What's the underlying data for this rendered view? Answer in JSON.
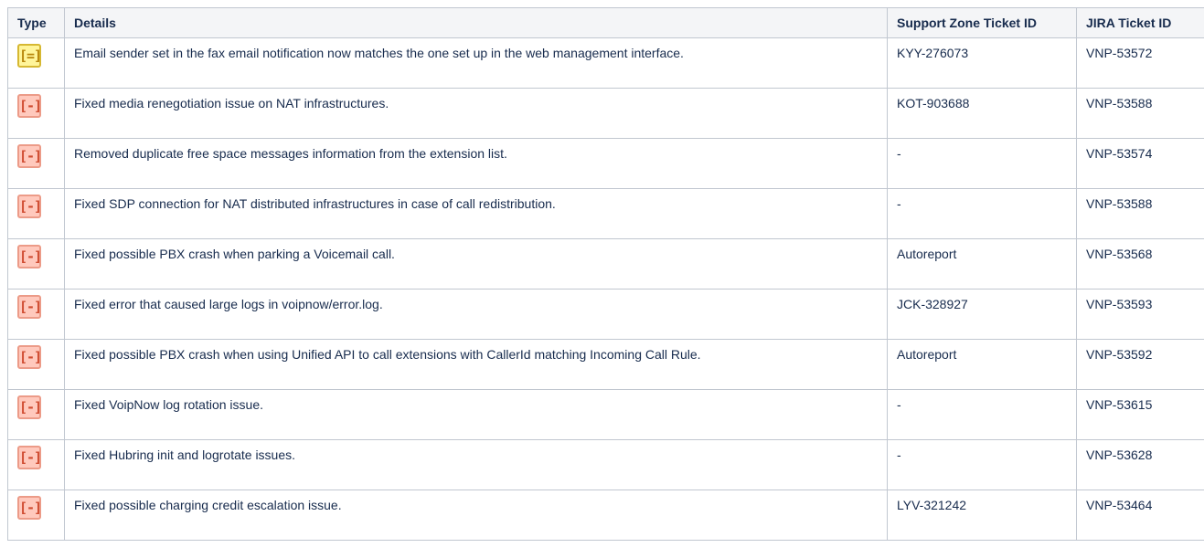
{
  "table": {
    "headers": {
      "type": "Type",
      "details": "Details",
      "support_zone": "Support Zone Ticket ID",
      "jira": "JIRA Ticket ID"
    },
    "rows": [
      {
        "icon": "changed-icon",
        "icon_glyph": "[=]",
        "details": "Email sender set in the fax email notification now matches the one set up in the web management interface.",
        "support_zone": "KYY-276073",
        "jira": "VNP-53572"
      },
      {
        "icon": "fixed-icon",
        "icon_glyph": "[-]",
        "details": "Fixed media renegotiation issue on NAT infrastructures.",
        "support_zone": "KOT-903688",
        "jira": "VNP-53588"
      },
      {
        "icon": "fixed-icon",
        "icon_glyph": "[-]",
        "details": "Removed duplicate free space messages information from the extension list.",
        "support_zone": "-",
        "jira": "VNP-53574"
      },
      {
        "icon": "fixed-icon",
        "icon_glyph": "[-]",
        "details": "Fixed SDP connection for NAT distributed infrastructures in case of call redistribution.",
        "support_zone": "-",
        "jira": "VNP-53588"
      },
      {
        "icon": "fixed-icon",
        "icon_glyph": "[-]",
        "details": "Fixed possible PBX crash when parking a Voicemail call.",
        "support_zone": "Autoreport",
        "jira": "VNP-53568"
      },
      {
        "icon": "fixed-icon",
        "icon_glyph": "[-]",
        "details": "Fixed error that caused large logs in voipnow/error.log.",
        "support_zone": "JCK-328927",
        "jira": "VNP-53593"
      },
      {
        "icon": "fixed-icon",
        "icon_glyph": "[-]",
        "details": "Fixed possible PBX crash when using Unified API to call extensions with CallerId matching Incoming Call Rule.",
        "support_zone": "Autoreport",
        "jira": "VNP-53592"
      },
      {
        "icon": "fixed-icon",
        "icon_glyph": "[-]",
        "details": "Fixed VoipNow log rotation issue.",
        "support_zone": "-",
        "jira": "VNP-53615"
      },
      {
        "icon": "fixed-icon",
        "icon_glyph": "[-]",
        "details": "Fixed Hubring init and logrotate issues.",
        "support_zone": "-",
        "jira": "VNP-53628"
      },
      {
        "icon": "fixed-icon",
        "icon_glyph": "[-]",
        "details": "Fixed possible charging credit escalation issue.",
        "support_zone": "LYV-321242",
        "jira": "VNP-53464"
      }
    ]
  },
  "colors": {
    "border": "#c1c7d0",
    "header_bg": "#f4f5f7",
    "changed_icon_bg": "#fff59a",
    "fixed_icon_bg": "#ffc9bd"
  }
}
